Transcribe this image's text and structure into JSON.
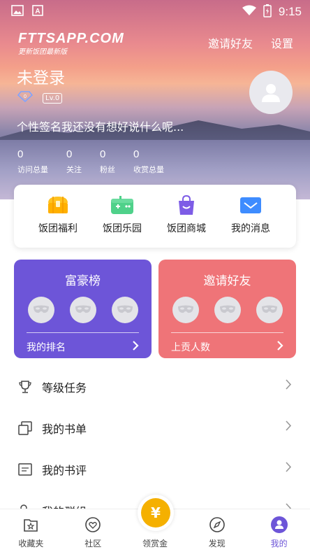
{
  "status_bar": {
    "time": "9:15",
    "icons": [
      "image-icon",
      "a-icon",
      "wifi-icon",
      "battery-icon"
    ]
  },
  "header": {
    "logo_main": "FTTSAPP.COM",
    "logo_sub": "更新饭团最新版",
    "invite_label": "邀请好友",
    "settings_label": "设置"
  },
  "profile": {
    "username": "未登录",
    "level": "Lv.0",
    "signature": "个性签名我还没有想好说什么呢...",
    "stats": [
      {
        "value": "0",
        "label": "访问总量"
      },
      {
        "value": "0",
        "label": "关注"
      },
      {
        "value": "0",
        "label": "粉丝"
      },
      {
        "value": "0",
        "label": "收赏总量"
      }
    ]
  },
  "quick_menu": [
    {
      "label": "饭团福利",
      "icon": "treasure-chest-icon"
    },
    {
      "label": "饭团乐园",
      "icon": "game-icon"
    },
    {
      "label": "饭团商城",
      "icon": "shopping-bag-icon"
    },
    {
      "label": "我的消息",
      "icon": "mail-icon"
    }
  ],
  "cards": {
    "rich_list": {
      "title": "富豪榜",
      "footer": "我的排名"
    },
    "invite": {
      "title": "邀请好友",
      "footer": "上贡人数"
    }
  },
  "menu": [
    {
      "label": "等级任务",
      "icon": "trophy-icon"
    },
    {
      "label": "我的书单",
      "icon": "booklist-icon"
    },
    {
      "label": "我的书评",
      "icon": "review-icon"
    },
    {
      "label": "我的群组",
      "icon": "group-icon"
    }
  ],
  "tabs": [
    {
      "label": "收藏夹",
      "icon": "favorites-icon"
    },
    {
      "label": "社区",
      "icon": "community-icon"
    },
    {
      "label": "领赏金",
      "icon": "yen-icon"
    },
    {
      "label": "发现",
      "icon": "compass-icon"
    },
    {
      "label": "我的",
      "icon": "profile-icon"
    }
  ],
  "colors": {
    "accent_purple": "#6d55d8",
    "accent_red": "#ef7478",
    "reward_gold": "#f5b000"
  }
}
